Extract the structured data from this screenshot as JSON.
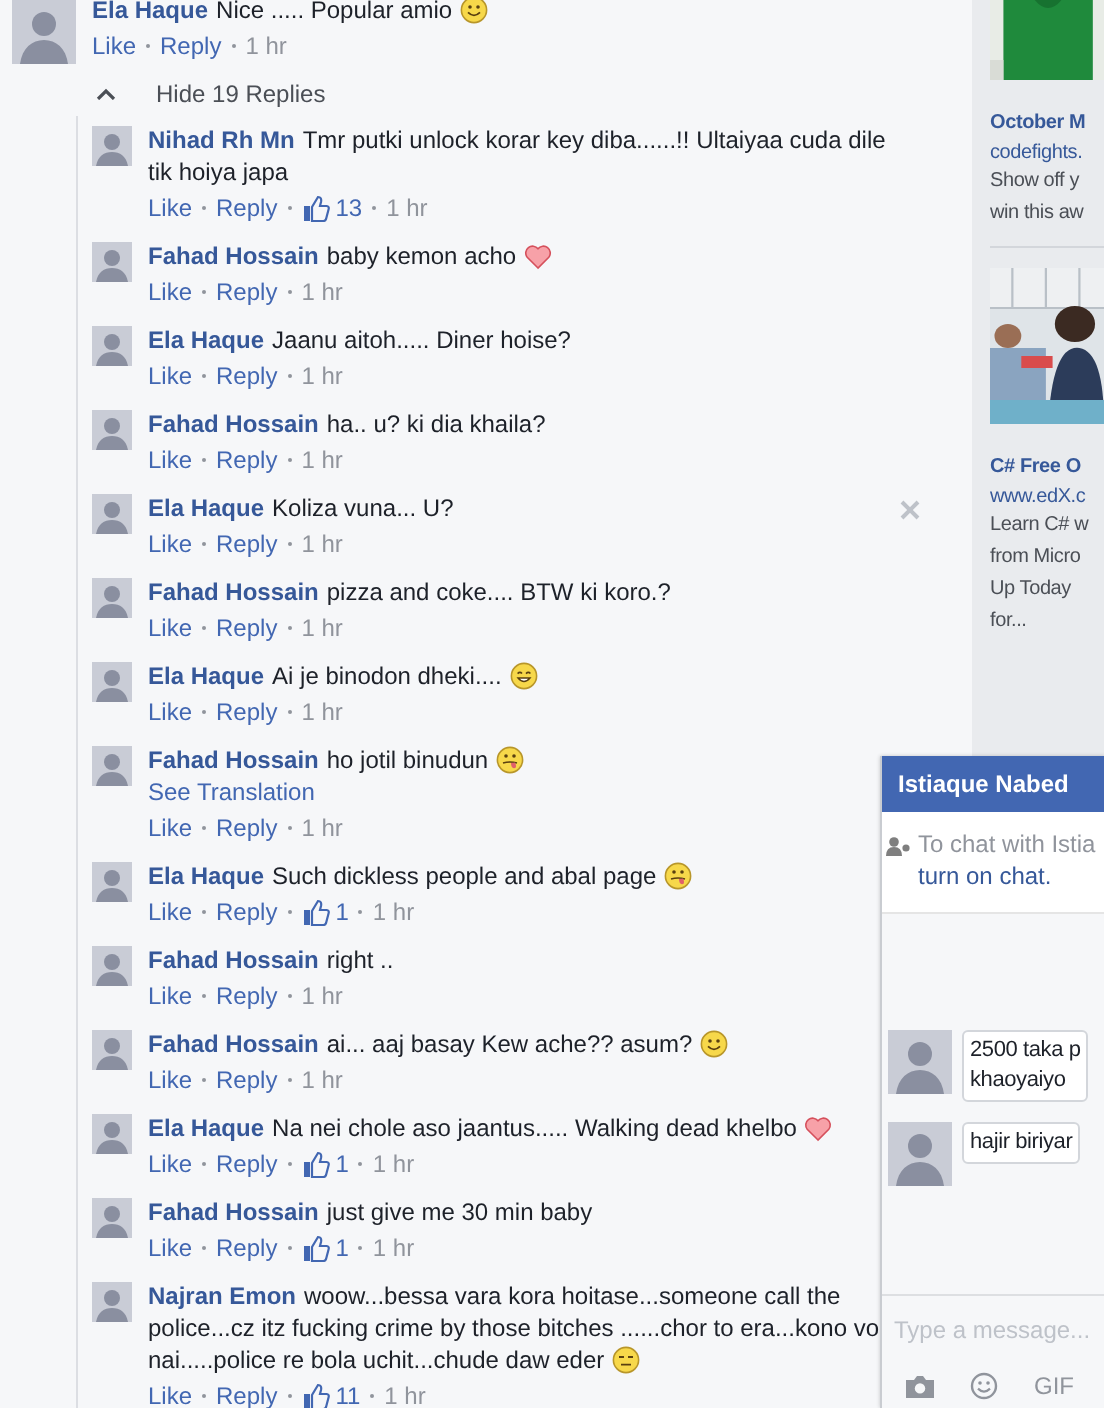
{
  "comment": {
    "author": "Ela Haque",
    "text": "Nice ..... Popular amio",
    "emoji": {
      "kind": "smile"
    },
    "actions": [
      "Like",
      "Reply"
    ],
    "time": "1 hr"
  },
  "replies_toggle": {
    "label": "Hide 19 Replies",
    "expanded": true
  },
  "replies": [
    {
      "author": "Nihad Rh Mn",
      "lines": [
        "Tmr putki unlock korar key diba......!! Ultaiyaa cuda dile",
        "tik hoiya japa"
      ],
      "actions": [
        "Like",
        "Reply"
      ],
      "likes": "13",
      "time": "1 hr",
      "hovered": false
    },
    {
      "author": "Fahad Hossain",
      "lines": [
        "baby kemon acho"
      ],
      "emoji": {
        "kind": "heart"
      },
      "actions": [
        "Like",
        "Reply"
      ],
      "time": "1 hr",
      "hovered": false
    },
    {
      "author": "Ela Haque",
      "lines": [
        "Jaanu aitoh..... Diner hoise?"
      ],
      "actions": [
        "Like",
        "Reply"
      ],
      "time": "1 hr",
      "hovered": false
    },
    {
      "author": "Fahad Hossain",
      "lines": [
        "ha.. u? ki dia khaila?"
      ],
      "actions": [
        "Like",
        "Reply"
      ],
      "time": "1 hr",
      "hovered": false
    },
    {
      "author": "Ela Haque",
      "lines": [
        "Koliza vuna... U?"
      ],
      "actions": [
        "Like",
        "Reply"
      ],
      "time": "1 hr",
      "hovered": true
    },
    {
      "author": "Fahad Hossain",
      "lines": [
        "pizza and coke.... BTW ki koro.?"
      ],
      "actions": [
        "Like",
        "Reply"
      ],
      "time": "1 hr",
      "hovered": false
    },
    {
      "author": "Ela Haque",
      "lines": [
        "Ai je binodon dheki...."
      ],
      "emoji": {
        "kind": "grin"
      },
      "actions": [
        "Like",
        "Reply"
      ],
      "time": "1 hr",
      "hovered": false
    },
    {
      "author": "Fahad Hossain",
      "lines": [
        "ho jotil binudun"
      ],
      "emoji": {
        "kind": "tongue"
      },
      "translation": "See Translation",
      "actions": [
        "Like",
        "Reply"
      ],
      "time": "1 hr",
      "hovered": false
    },
    {
      "author": "Ela Haque",
      "lines": [
        "Such dickless people and abal page"
      ],
      "emoji": {
        "kind": "tongue"
      },
      "actions": [
        "Like",
        "Reply"
      ],
      "likes": "1",
      "time": "1 hr",
      "hovered": false
    },
    {
      "author": "Fahad Hossain",
      "lines": [
        "right .."
      ],
      "actions": [
        "Like",
        "Reply"
      ],
      "time": "1 hr",
      "hovered": false
    },
    {
      "author": "Fahad Hossain",
      "lines": [
        "ai... aaj basay Kew ache?? asum?"
      ],
      "emoji": {
        "kind": "smile"
      },
      "actions": [
        "Like",
        "Reply"
      ],
      "time": "1 hr",
      "hovered": false
    },
    {
      "author": "Ela Haque",
      "lines": [
        "Na nei chole aso jaantus..... Walking dead khelbo"
      ],
      "emoji": {
        "kind": "heart"
      },
      "actions": [
        "Like",
        "Reply"
      ],
      "likes": "1",
      "time": "1 hr",
      "hovered": false
    },
    {
      "author": "Fahad Hossain",
      "lines": [
        "just give me 30 min baby"
      ],
      "actions": [
        "Like",
        "Reply"
      ],
      "likes": "1",
      "time": "1 hr",
      "hovered": false
    },
    {
      "author": "Najran Emon",
      "lines": [
        "woow...bessa vara kora hoitase...someone call the",
        "police...cz itz fucking crime by those bitches ......chor to era...kono vo",
        "nai.....police re bola uchit...chude daw eder"
      ],
      "emoji": {
        "kind": "meh"
      },
      "actions": [
        "Like",
        "Reply"
      ],
      "likes": "11",
      "time": "1 hr",
      "hovered": false
    }
  ],
  "ads": [
    {
      "title": "October M",
      "domain": "codefights.",
      "lines": [
        "Show off y",
        "win this aw"
      ]
    },
    {
      "title": "C# Free O",
      "domain": "www.edX.c",
      "lines": [
        "Learn C# w",
        "from Micro",
        "Up Today",
        "for..."
      ]
    }
  ],
  "chat": {
    "title": "Istiaque Nabed",
    "notice": "To chat with Istia",
    "notice_link": "turn on chat.",
    "messages": [
      {
        "lines": [
          "2500 taka p",
          "khaoyaiyo"
        ]
      },
      {
        "lines": [
          "hajir biriyar"
        ]
      }
    ],
    "placeholder": "Type a message...",
    "gif_label": "GIF"
  }
}
